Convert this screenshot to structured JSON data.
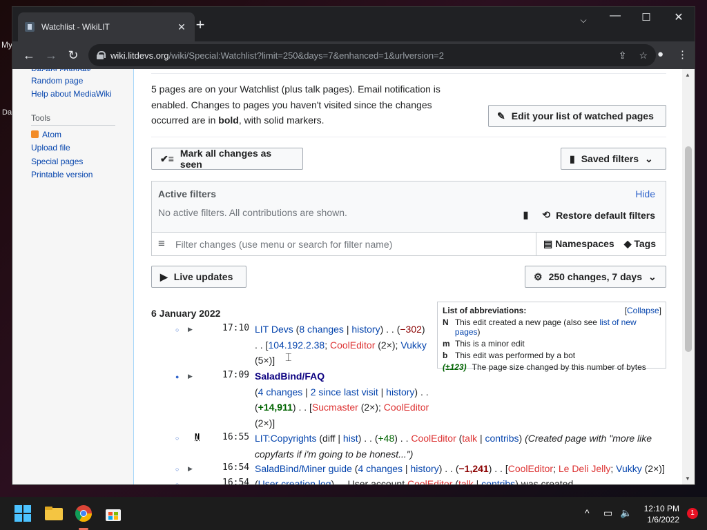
{
  "desktop": {
    "label_1": "My",
    "label_2": "Da"
  },
  "browser": {
    "tab_title": "Watchlist - WikiLIT",
    "url_host": "wiki.litdevs.org",
    "url_path": "/wiki/Special:Watchlist?limit=250&days=7&enhanced=1&urlversion=2"
  },
  "sidebar": {
    "links_top": [
      "Random page",
      "Help about MediaWiki"
    ],
    "tools_heading": "Tools",
    "tools": [
      "Atom",
      "Upload file",
      "Special pages",
      "Printable version"
    ]
  },
  "intro": {
    "text_1": "5 pages are on your Watchlist (plus talk pages). Email notification is enabled. Changes to pages you haven't visited since the changes occurred are in ",
    "bold": "bold",
    "text_2": ", with solid markers."
  },
  "buttons": {
    "edit_watched": "Edit your list of watched pages",
    "mark_seen": "Mark all changes as seen",
    "saved_filters": "Saved filters",
    "live_updates": "Live updates",
    "changes_days": "250 changes, 7 days"
  },
  "filters": {
    "heading": "Active filters",
    "hide": "Hide",
    "none": "No active filters. All contributions are shown.",
    "restore": "Restore default filters",
    "placeholder": "Filter changes (use menu or search for filter name)",
    "namespaces": "Namespaces",
    "tags": "Tags"
  },
  "date_heading": "6 January 2022",
  "abbreviations": {
    "title": "List of abbreviations:",
    "collapse": "Collapse",
    "rows": [
      {
        "key": "N",
        "text": "This edit created a new page (also see ",
        "link": "list of new pages",
        "tail": ")"
      },
      {
        "key": "m",
        "text": "This is a minor edit",
        "link": "",
        "tail": ""
      },
      {
        "key": "b",
        "text": "This edit was performed by a bot",
        "link": "",
        "tail": ""
      },
      {
        "key": "(±123)",
        "text": "The page size changed by this number of bytes",
        "link": "",
        "tail": ""
      }
    ]
  },
  "changes": [
    {
      "time": "17:10",
      "page": "LIT Devs",
      "changes": "8 changes",
      "history": "history",
      "diff": "−302",
      "ip": "104.192.2.38",
      "user1": "CoolEditor",
      "user1_count": "(2×)",
      "user2": "Vukky",
      "user2_count": "(5×)"
    },
    {
      "time": "17:09",
      "page": "SaladBind/FAQ",
      "changes": "4 changes",
      "since": "2 since last visit",
      "history": "history",
      "diff": "+14,911",
      "user1": "Sucmaster",
      "user1_count": "(2×)",
      "user2": "CoolEditor",
      "user2_count": "(2×)"
    },
    {
      "time": "16:55",
      "flag": "N",
      "page": "LIT:Copyrights",
      "diff_link": "diff",
      "hist": "hist",
      "diff": "+48",
      "user": "CoolEditor",
      "talk": "talk",
      "contribs": "contribs",
      "summary": "(Created page with \"more like copyfarts if i'm going to be honest...\")"
    },
    {
      "time": "16:54",
      "page": "SaladBind/Miner guide",
      "changes": "4 changes",
      "history": "history",
      "diff": "−1,241",
      "user1": "CoolEditor",
      "user2": "Le Deli Jelly",
      "user3": "Vukky",
      "user3_count": "(2×)"
    },
    {
      "time": "16:54",
      "log": "User creation log",
      "text": "User account",
      "user": "CoolEditor",
      "talk": "talk",
      "contribs": "contribs",
      "tail": "was created"
    }
  ],
  "taskbar": {
    "time": "12:10 PM",
    "date": "1/6/2022",
    "notifications": "1"
  }
}
